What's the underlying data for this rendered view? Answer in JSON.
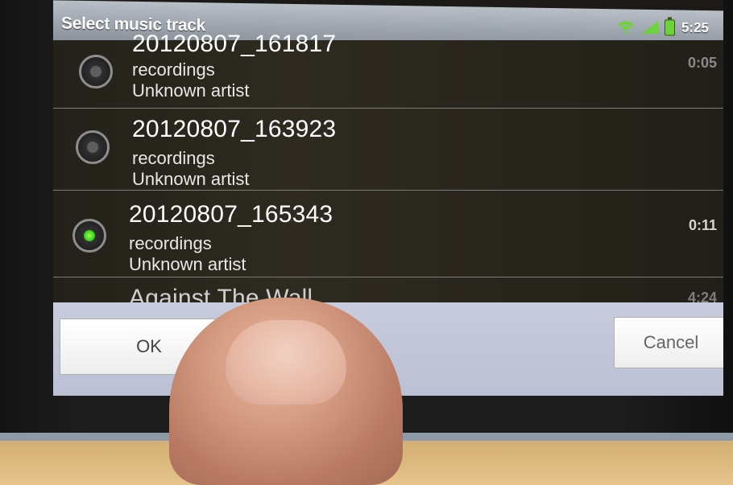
{
  "dialog": {
    "title": "Select music track"
  },
  "status_bar": {
    "time": "5:25",
    "icons": [
      "wifi-icon",
      "signal-icon",
      "battery-icon"
    ]
  },
  "tracks": [
    {
      "title": "20120807_161817",
      "album": "recordings",
      "artist": "Unknown artist",
      "duration": "0:05",
      "selected": false
    },
    {
      "title": "20120807_163923",
      "album": "recordings",
      "artist": "Unknown artist",
      "duration": "",
      "selected": false
    },
    {
      "title": "20120807_165343",
      "album": "recordings",
      "artist": "Unknown artist",
      "duration": "0:11",
      "selected": true
    },
    {
      "title": "Against The Wall",
      "album": "",
      "artist": "",
      "duration": "4:24",
      "selected": false
    }
  ],
  "buttons": {
    "ok_label": "OK",
    "cancel_label": "Cancel"
  },
  "colors": {
    "selected_radio": "#3bd11c",
    "title_bar": "#9ba3ad",
    "list_background": "#2a261d"
  }
}
